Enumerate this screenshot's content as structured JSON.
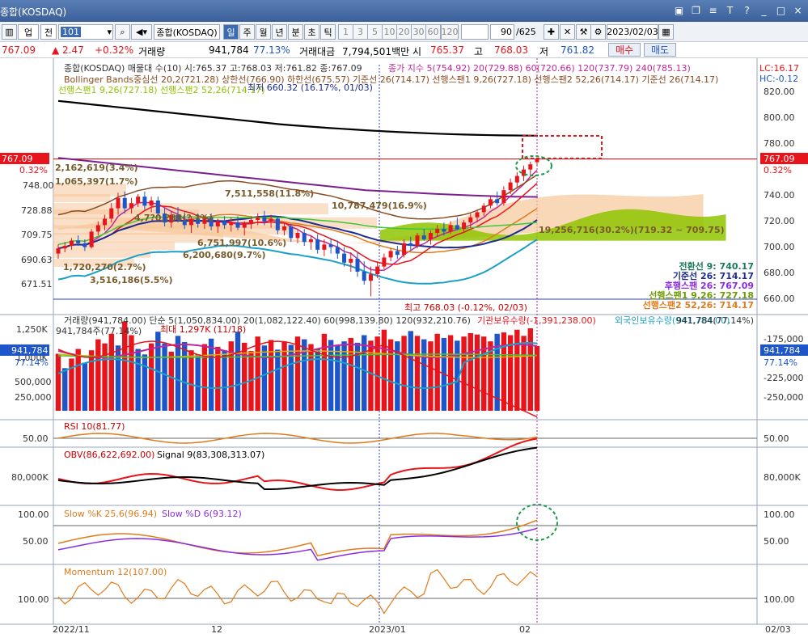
{
  "window": {
    "title": "종합(KOSDAQ)",
    "title_buttons": [
      "▣",
      "❐",
      "≡",
      "T",
      "?",
      "_",
      "□",
      "×"
    ]
  },
  "toolbar": {
    "code_value": "101",
    "name_value": "종합(KOSDAQ)",
    "left_labels": [
      "업",
      "전"
    ],
    "period_tabs": [
      "일",
      "주",
      "월",
      "년",
      "분",
      "초",
      "틱"
    ],
    "period_selected": "일",
    "minute_options": [
      "1",
      "3",
      "5",
      "10",
      "20",
      "30",
      "60",
      "120"
    ],
    "count_value": "90",
    "count_total": "/625",
    "date_value": "2023/02/03"
  },
  "quote": {
    "price": "767.09",
    "change": "▲  2.47",
    "change_pct": "+0.32%",
    "volume_label": "거래량",
    "volume": "941,784",
    "volume_pct": "77.13%",
    "amount_label": "거래대금",
    "amount": "7,794,501백만",
    "open_label": "시",
    "open": "765.37",
    "high_label": "고",
    "high": "768.03",
    "low_label": "저",
    "low": "761.82",
    "buy_label": "매수",
    "sell_label": "매도"
  },
  "colors": {
    "up": "#e8141b",
    "down": "#1e55c8",
    "cloud_up": "#8fc400",
    "cloud_down": "#f6c79a"
  },
  "price_panel": {
    "legend_line1": "종합(KOSDAQ) 매물대 수(10)  시:765.37 고:768.03 저:761.82 종:767.09",
    "legend_ma": "종가 지수 5(754.92)  20(729.88)  60(720.66)  120(737.79)  240(785.13)",
    "legend_line2": "Bollinger Bands중심선 20,2(721.28)  상한선(766.90)  하한선(675.57)  기준선 26(714.17)  선행스팬1 9,26(727.18)  선행스팬2 52,26(714.17)  기준선 26(714.17)",
    "legend_line3": "선행스팬1 9,26(727.18)  선행스팬2 52,26(714.17)",
    "low_note": "최저 660.32 (16.17%, 01/03)",
    "high_note": "최고 768.03 (-0.12%, 02/03)",
    "lc": "LC:16.17",
    "hc": "HC:-0.12",
    "y_ticks": [
      "820.00",
      "800.00",
      "780.00",
      "760.00",
      "740.00",
      "720.00",
      "700.00",
      "680.00",
      "660.00"
    ],
    "left_ticks": [
      "748.00",
      "728.88",
      "709.75",
      "690.63",
      "671.51"
    ],
    "price_tag": "767.09",
    "price_tag_pct": "0.32%",
    "volume_profile_labels": [
      "2,162,619(3.4%)",
      "1,065,397(1.7%)",
      "7,511,558(11.8%)",
      "4,7?0,?88(?.?%)",
      "10,787,479(16.9%)",
      "6,751,997(10.6%)",
      "6,200,680(9.7%)",
      "1,720,270(2.7%)",
      "3,516,186(5.5%)",
      "19,256,716(30.2%)(719.32 ~ 709.75)"
    ],
    "ichimoku_box": [
      "전환선  9: 740.17",
      "기준선  26: 714.17",
      "후행스팬  26: 767.09",
      "선행스팬1 9,26: 727.18",
      "선행스팬2 52,26: 714.17"
    ]
  },
  "volume_panel": {
    "legend": "거래량(941,784.00)  단순 5(1,050,834.00)  20(1,082,122.40)  60(998,139.80)  120(932,210.76)",
    "legend_inst": "기관보유수량(-1,391,238.00)",
    "legend_foreign": "외국인보유수량(941,784.00)",
    "legend_tag": "941,784(77.14%)",
    "sub_note": "941,784주(77.14%)",
    "max_note": "최대 1,297K (11/18)",
    "tag": "941,784",
    "tag_pct": "77.14%",
    "left_ticks": [
      "1,250K",
      "1,000K",
      "750,000",
      "500,000",
      "250,000"
    ],
    "right_ticks": [
      "-175,000",
      "-200,000",
      "-225,000",
      "-250,000"
    ]
  },
  "rsi_panel": {
    "legend": "RSI 10(81.77)",
    "left_tick": "50.00",
    "right_tick": "50.00"
  },
  "obv_panel": {
    "legend_obv": "OBV(86,622,692.00)",
    "legend_sig": "Signal 9(83,308,313.07)",
    "left_tick": "80,000K",
    "right_tick": "80,000K"
  },
  "stoch_panel": {
    "legend_k": "Slow %K 25,6(96.94)",
    "legend_d": "Slow %D 6(93.12)",
    "left_ticks": [
      "100.00",
      "50.00"
    ],
    "right_ticks": [
      "100.00",
      "50.00"
    ]
  },
  "mom_panel": {
    "legend": "Momentum 12(107.00)",
    "left_tick": "100.00",
    "right_tick": "100.00"
  },
  "x_axis": {
    "labels": [
      "2022/11",
      "12",
      "2023/01",
      "02"
    ],
    "right_label": "02/03"
  },
  "chart_data": {
    "type": "candlestick",
    "y_range": [
      660,
      830
    ],
    "candles": [
      [
        694,
        701,
        690,
        698
      ],
      [
        698,
        703,
        695,
        700
      ],
      [
        700,
        706,
        697,
        704
      ],
      [
        704,
        708,
        700,
        702
      ],
      [
        702,
        705,
        696,
        699
      ],
      [
        699,
        713,
        698,
        711
      ],
      [
        711,
        719,
        708,
        716
      ],
      [
        716,
        724,
        712,
        721
      ],
      [
        721,
        733,
        718,
        729
      ],
      [
        729,
        741,
        724,
        737
      ],
      [
        737,
        742,
        725,
        729
      ],
      [
        729,
        737,
        725,
        733
      ],
      [
        733,
        740,
        730,
        738
      ],
      [
        738,
        742,
        728,
        731
      ],
      [
        731,
        738,
        726,
        735
      ],
      [
        735,
        738,
        723,
        725
      ],
      [
        725,
        729,
        715,
        718
      ],
      [
        718,
        727,
        714,
        724
      ],
      [
        724,
        730,
        718,
        720
      ],
      [
        720,
        726,
        713,
        716
      ],
      [
        716,
        723,
        710,
        721
      ],
      [
        721,
        725,
        714,
        717
      ],
      [
        717,
        724,
        713,
        722
      ],
      [
        722,
        725,
        712,
        715
      ],
      [
        715,
        721,
        710,
        719
      ],
      [
        719,
        723,
        713,
        716
      ],
      [
        716,
        722,
        711,
        718
      ],
      [
        718,
        723,
        712,
        714
      ],
      [
        714,
        719,
        708,
        717
      ],
      [
        717,
        723,
        713,
        720
      ],
      [
        720,
        725,
        716,
        722
      ],
      [
        722,
        727,
        716,
        719
      ],
      [
        719,
        724,
        714,
        721
      ],
      [
        721,
        723,
        709,
        712
      ],
      [
        712,
        718,
        708,
        715
      ],
      [
        715,
        717,
        703,
        706
      ],
      [
        706,
        713,
        702,
        710
      ],
      [
        710,
        713,
        700,
        703
      ],
      [
        703,
        708,
        697,
        705
      ],
      [
        705,
        709,
        694,
        697
      ],
      [
        697,
        705,
        692,
        701
      ],
      [
        701,
        706,
        694,
        699
      ],
      [
        699,
        704,
        690,
        694
      ],
      [
        694,
        699,
        684,
        687
      ],
      [
        687,
        695,
        680,
        690
      ],
      [
        690,
        695,
        676,
        680
      ],
      [
        680,
        688,
        670,
        673
      ],
      [
        673,
        684,
        661,
        678
      ],
      [
        678,
        688,
        675,
        684
      ],
      [
        684,
        694,
        682,
        691
      ],
      [
        691,
        698,
        688,
        696
      ],
      [
        696,
        700,
        690,
        693
      ],
      [
        693,
        705,
        691,
        702
      ],
      [
        702,
        707,
        697,
        700
      ],
      [
        700,
        710,
        698,
        708
      ],
      [
        708,
        713,
        704,
        705
      ],
      [
        705,
        712,
        701,
        710
      ],
      [
        710,
        716,
        707,
        713
      ],
      [
        713,
        718,
        708,
        711
      ],
      [
        711,
        719,
        709,
        716
      ],
      [
        716,
        722,
        712,
        713
      ],
      [
        713,
        720,
        710,
        718
      ],
      [
        718,
        725,
        714,
        722
      ],
      [
        722,
        728,
        718,
        726
      ],
      [
        726,
        733,
        723,
        731
      ],
      [
        731,
        738,
        729,
        736
      ],
      [
        736,
        742,
        731,
        733
      ],
      [
        733,
        746,
        731,
        743
      ],
      [
        743,
        752,
        740,
        749
      ],
      [
        749,
        757,
        745,
        754
      ],
      [
        754,
        762,
        750,
        759
      ],
      [
        759,
        765,
        755,
        763
      ],
      [
        764.62,
        768.03,
        761.82,
        767.09
      ]
    ],
    "ma240": [
      812,
      811,
      810,
      809,
      808,
      807,
      806,
      805,
      804,
      803,
      802,
      801,
      800,
      799,
      798,
      797,
      796,
      795,
      794,
      793.2,
      792.5,
      791.8,
      791.1,
      790.5,
      789.9,
      789.3,
      788.8,
      788.3,
      787.8,
      787.4,
      787,
      786.6,
      786.3,
      786,
      785.8,
      785.6,
      785.4,
      785.3,
      785.2,
      785.13
    ],
    "ma120": [
      768,
      767,
      766,
      765,
      764,
      763,
      762,
      761,
      760,
      759,
      758,
      757,
      756,
      755,
      754,
      753,
      752,
      751,
      750,
      749,
      748,
      747,
      746,
      745,
      744,
      743,
      742.5,
      742,
      741.5,
      741,
      740.5,
      740,
      739.6,
      739.2,
      738.8,
      738.5,
      738.2,
      738,
      737.9,
      737.79
    ]
  },
  "volume_data": {
    "values": [
      830,
      620,
      760,
      900,
      700,
      880,
      1040,
      980,
      1120,
      950,
      1297,
      1100,
      900,
      820,
      980,
      1150,
      980,
      860,
      1090,
      1000,
      880,
      820,
      970,
      1050,
      930,
      880,
      1010,
      1150,
      990,
      870,
      1080,
      950,
      1030,
      890,
      1010,
      960,
      1080,
      1040,
      970,
      900,
      1120,
      1030,
      950,
      1010,
      1060,
      990,
      1100,
      1020,
      1080,
      1180,
      1040,
      1010,
      1090,
      1160,
      1090,
      1040,
      1010,
      1120,
      1060,
      1100,
      1020,
      1080,
      1130,
      1110,
      1080,
      1010,
      1120,
      1140,
      1100,
      1180,
      1090,
      1200,
      941.784
    ],
    "up": [
      1,
      0,
      1,
      1,
      0,
      1,
      1,
      1,
      1,
      0,
      1,
      1,
      0,
      0,
      1,
      0,
      0,
      1,
      0,
      0,
      1,
      0,
      1,
      0,
      1,
      0,
      1,
      0,
      1,
      1,
      1,
      0,
      1,
      0,
      1,
      0,
      1,
      0,
      1,
      0,
      1,
      0,
      0,
      0,
      1,
      0,
      0,
      1,
      1,
      1,
      1,
      0,
      1,
      0,
      1,
      0,
      1,
      1,
      0,
      1,
      0,
      1,
      1,
      1,
      1,
      1,
      0,
      1,
      1,
      1,
      1,
      1,
      1
    ]
  }
}
